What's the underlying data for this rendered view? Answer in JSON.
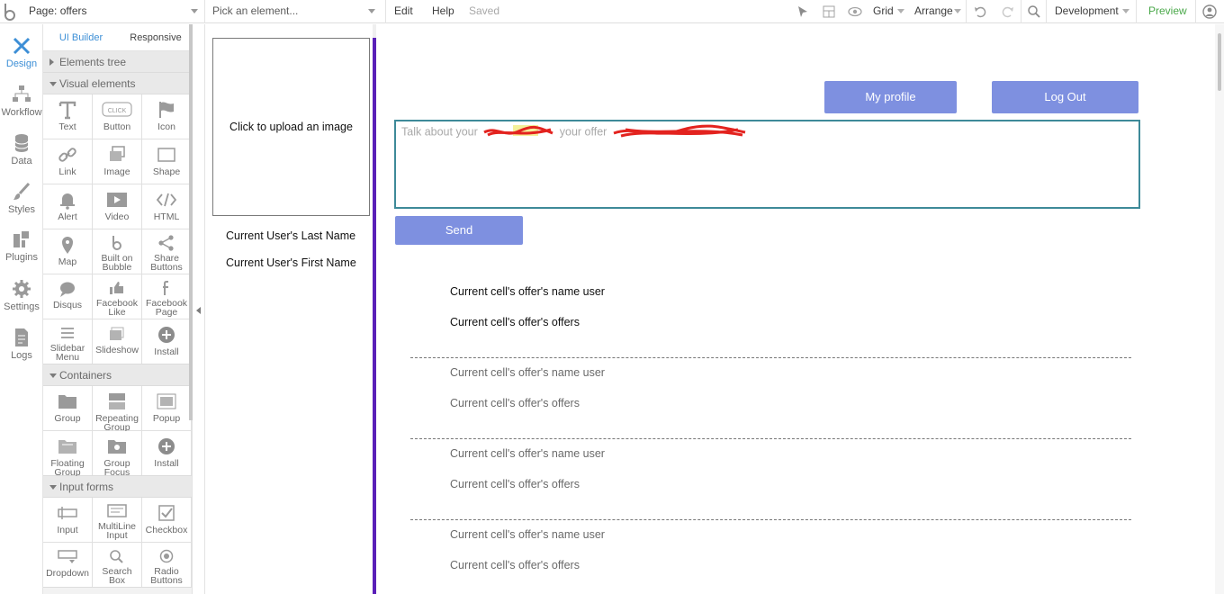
{
  "topbar": {
    "page_select": "Page: offers",
    "element_select": "Pick an element...",
    "edit": "Edit",
    "help": "Help",
    "saved": "Saved",
    "grid": "Grid",
    "arrange": "Arrange",
    "environment": "Development",
    "preview": "Preview"
  },
  "rail": [
    {
      "label": "Design"
    },
    {
      "label": "Workflow"
    },
    {
      "label": "Data"
    },
    {
      "label": "Styles"
    },
    {
      "label": "Plugins"
    },
    {
      "label": "Settings"
    },
    {
      "label": "Logs"
    }
  ],
  "palette": {
    "tabs": [
      "UI Builder",
      "Responsive"
    ],
    "elements_tree": "Elements tree",
    "visual_title": "Visual elements",
    "visual": [
      "Text",
      "Button",
      "Icon",
      "Link",
      "Image",
      "Shape",
      "Alert",
      "Video",
      "HTML",
      "Map",
      "Built on Bubble",
      "Share Buttons",
      "Disqus",
      "Facebook Like",
      "Facebook Page",
      "Slidebar Menu",
      "Slideshow",
      "Install"
    ],
    "containers_title": "Containers",
    "containers": [
      "Group",
      "Repeating Group",
      "Popup",
      "Floating Group",
      "Group Focus",
      "Install"
    ],
    "inputs_title": "Input forms",
    "inputs": [
      "Input",
      "MultiLine Input",
      "Checkbox",
      "Dropdown",
      "Search Box",
      "Radio Buttons"
    ]
  },
  "canvas": {
    "upload_text": "Click to upload an image",
    "last_name": "Current User's Last Name",
    "first_name": "Current User's First Name",
    "my_profile": "My profile",
    "log_out": "Log Out",
    "textarea_placeholder": "Talk about your",
    "textarea_placeholder_mid": "your offer",
    "send": "Send",
    "rows": [
      {
        "name": "Current cell's offer's name user",
        "offers": "Current cell's offer's offers"
      },
      {
        "name": "Current cell's offer's name user",
        "offers": "Current cell's offer's offers"
      },
      {
        "name": "Current cell's offer's name user",
        "offers": "Current cell's offer's offers"
      },
      {
        "name": "Current cell's offer's name user",
        "offers": "Current cell's offer's offers"
      }
    ]
  },
  "colors": {
    "accent": "#3d8fd6",
    "button": "#7e90e0",
    "purple_bar": "#5a1fb8",
    "textarea_border": "#3e8a99",
    "preview": "#4aa84a"
  }
}
